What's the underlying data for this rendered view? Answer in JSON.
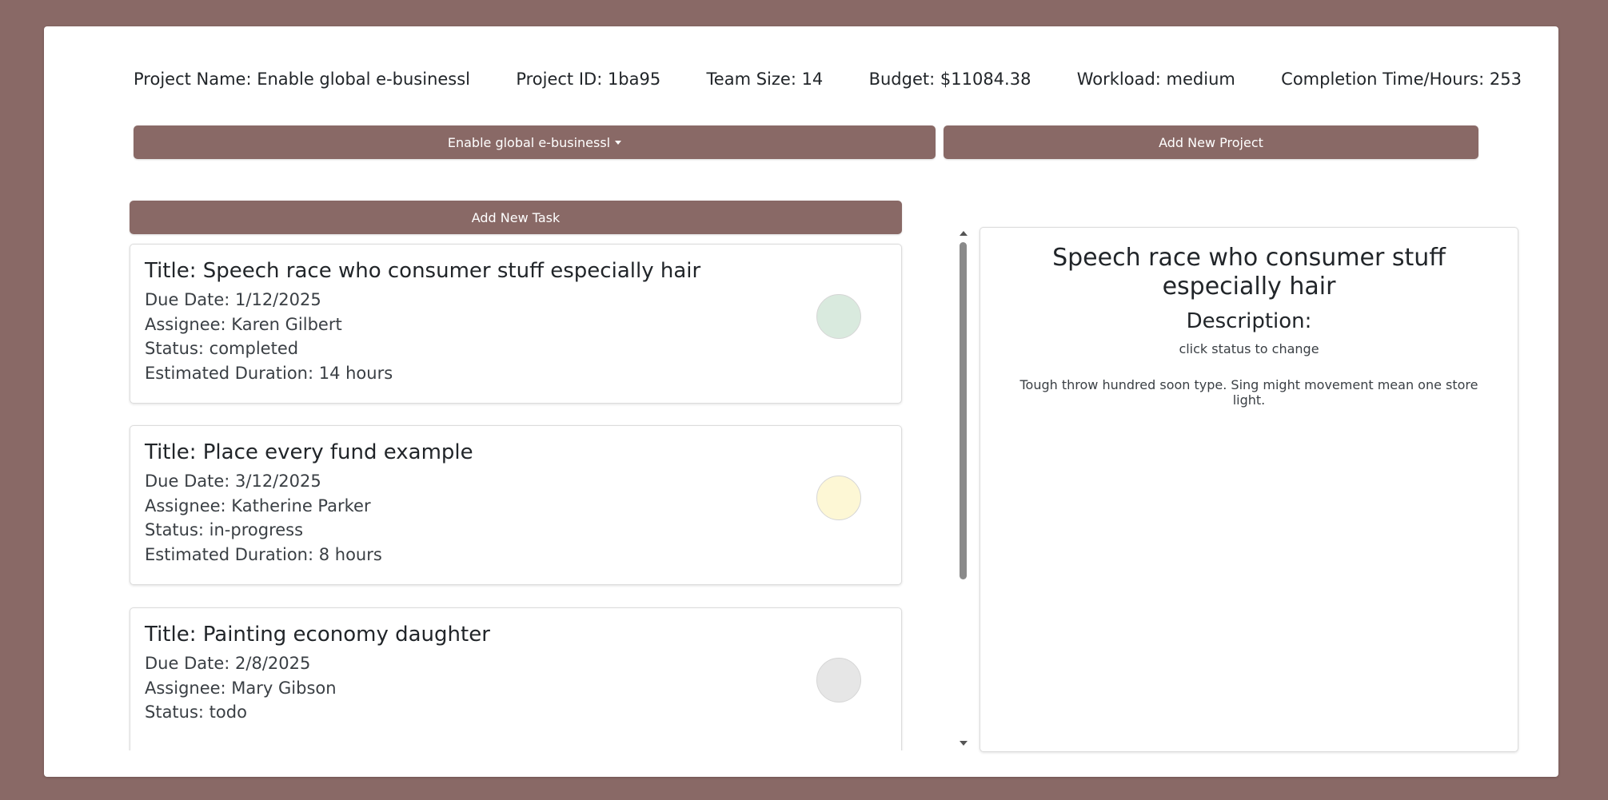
{
  "project_info": {
    "name": "Project Name: Enable global e-businessl",
    "id": "Project ID: 1ba95",
    "team_size": "Team Size: 14",
    "budget": "Budget: $11084.38",
    "workload": "Workload: medium",
    "completion": "Completion Time/Hours: 253"
  },
  "controls": {
    "project_dropdown_label": "Enable global e-businessl",
    "add_project_label": "Add New Project",
    "add_task_label": "Add New Task"
  },
  "tasks": [
    {
      "title": "Title: Speech race who consumer stuff especially hair",
      "due": "Due Date: 1/12/2025",
      "assignee": "Assignee: Karen Gilbert",
      "status": "Status: completed",
      "duration": "Estimated Duration: 14 hours",
      "status_color": "#d9eade"
    },
    {
      "title": "Title: Place every fund example",
      "due": "Due Date: 3/12/2025",
      "assignee": "Assignee: Katherine Parker",
      "status": "Status: in-progress",
      "duration": "Estimated Duration: 8 hours",
      "status_color": "#fdf7d5"
    },
    {
      "title": "Title: Painting economy daughter",
      "due": "Due Date: 2/8/2025",
      "assignee": "Assignee: Mary Gibson",
      "status": "Status: todo",
      "duration": "",
      "status_color": "#e6e6e6"
    }
  ],
  "detail": {
    "title": "Speech race who consumer stuff especially hair",
    "description_heading": "Description:",
    "hint": "click status to change",
    "description": "Tough throw hundred soon type. Sing might movement mean one store light."
  },
  "colors": {
    "background": "#896966",
    "button": "#896966"
  }
}
